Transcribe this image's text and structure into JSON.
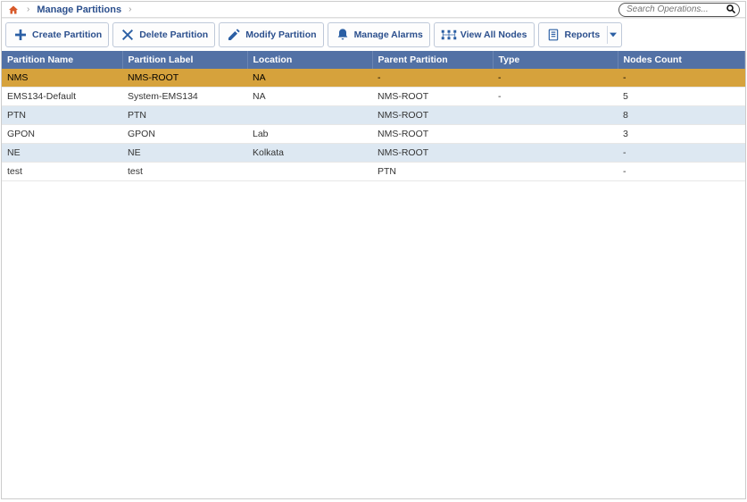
{
  "breadcrumb": {
    "page": "Manage Partitions"
  },
  "search": {
    "placeholder": "Search Operations..."
  },
  "toolbar": {
    "create": "Create Partition",
    "delete": "Delete Partition",
    "modify": "Modify Partition",
    "alarms": "Manage Alarms",
    "viewall": "View All Nodes",
    "reports": "Reports"
  },
  "columns": {
    "name": "Partition Name",
    "label": "Partition Label",
    "location": "Location",
    "parent": "Parent Partition",
    "type": "Type",
    "nodes": "Nodes Count"
  },
  "rows": [
    {
      "name": "NMS",
      "label": "NMS-ROOT",
      "location": "NA",
      "parent": "-",
      "type": "-",
      "nodes": "-",
      "rowclass": "selected"
    },
    {
      "name": "EMS134-Default",
      "label": "System-EMS134",
      "location": "NA",
      "parent": "NMS-ROOT",
      "type": "-",
      "nodes": "5",
      "rowclass": "plain"
    },
    {
      "name": "PTN",
      "label": "PTN",
      "location": "",
      "parent": "NMS-ROOT",
      "type": "",
      "nodes": "8",
      "rowclass": "alt"
    },
    {
      "name": "GPON",
      "label": "GPON",
      "location": "Lab",
      "parent": "NMS-ROOT",
      "type": "",
      "nodes": "3",
      "rowclass": "plain"
    },
    {
      "name": "NE",
      "label": "NE",
      "location": "Kolkata",
      "parent": "NMS-ROOT",
      "type": "",
      "nodes": "-",
      "rowclass": "alt"
    },
    {
      "name": "test",
      "label": "test",
      "location": "",
      "parent": "PTN",
      "type": "",
      "nodes": "-",
      "rowclass": "plain"
    }
  ]
}
